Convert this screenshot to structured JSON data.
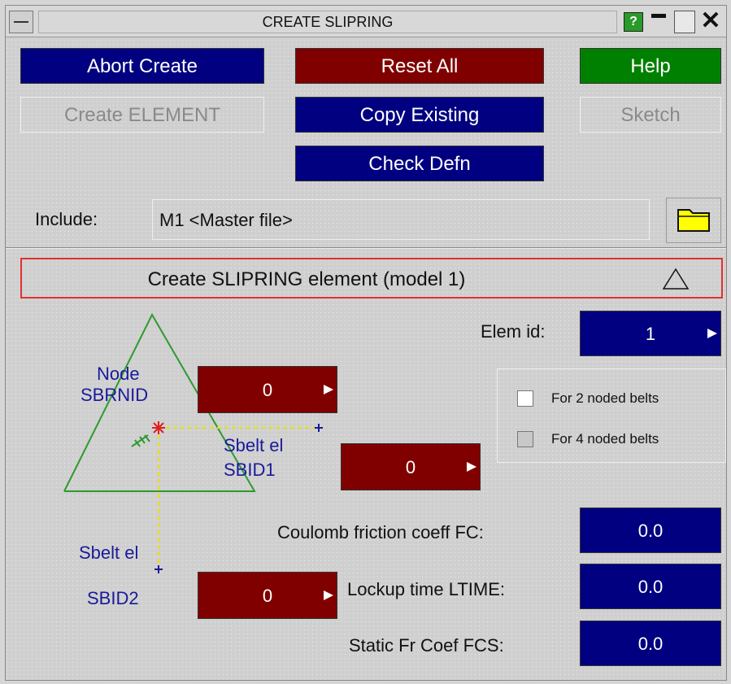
{
  "window": {
    "title": "CREATE SLIPRING",
    "help_glyph": "?"
  },
  "toolbar": {
    "abort_create": "Abort Create",
    "reset_all": "Reset All",
    "help": "Help",
    "create_element": "Create ELEMENT",
    "copy_existing": "Copy Existing",
    "sketch": "Sketch",
    "check_defn": "Check Defn"
  },
  "include": {
    "label": "Include:",
    "value": "M1  <Master file>"
  },
  "section": {
    "title": "Create SLIPRING element (model 1)"
  },
  "elem_id": {
    "label": "Elem id:",
    "value": "1"
  },
  "diagram": {
    "node_label_1": "Node",
    "node_label_2": "SBRNID",
    "sbid1_label_1": "Sbelt el",
    "sbid1_label_2": "SBID1",
    "sbid2_label_1": "Sbelt el",
    "sbid2_label_2": "SBID2"
  },
  "fields": {
    "sbrnid": "0",
    "sbid1": "0",
    "sbid2": "0"
  },
  "options": {
    "two_noded": "For 2 noded belts",
    "four_noded": "For 4 noded belts"
  },
  "params": {
    "fc_label": "Coulomb friction coeff FC:",
    "fc_value": "0.0",
    "ltime_label": "Lockup time LTIME:",
    "ltime_value": "0.0",
    "fcs_label": "Static Fr Coef FCS:",
    "fcs_value": "0.0"
  },
  "colors": {
    "navy": "#000080",
    "maroon": "#800000",
    "green": "#008000",
    "diagram_green": "#2e9a2e",
    "label_blue": "#1a1a9a",
    "node_red": "#e02020",
    "guide_yellow": "#e8e000"
  }
}
